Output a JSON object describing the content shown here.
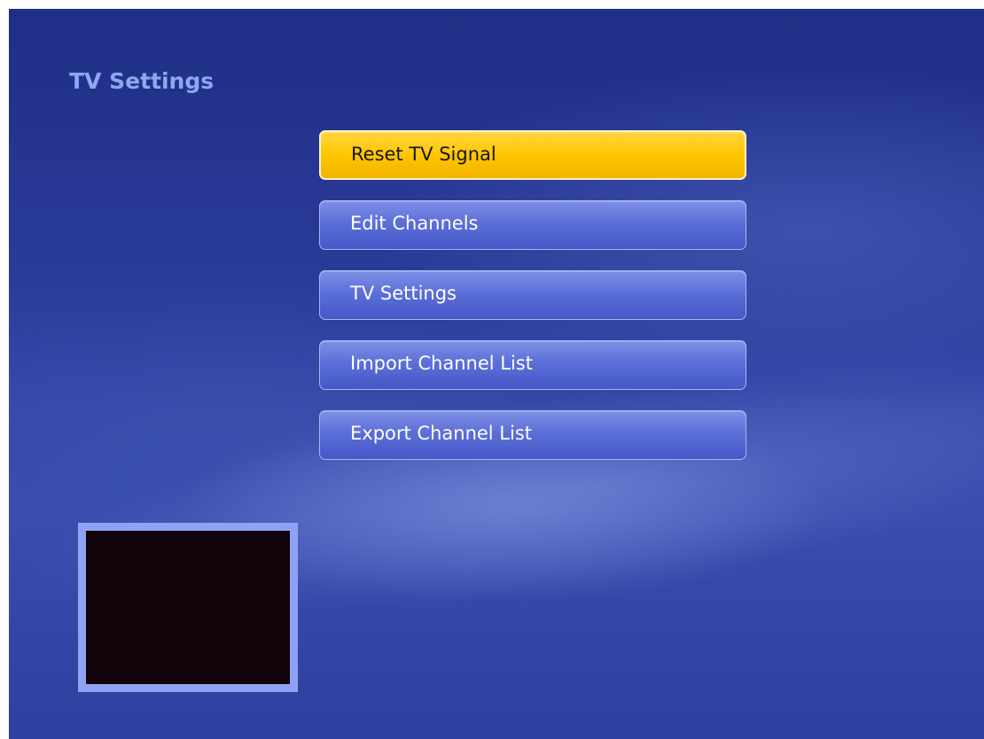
{
  "page": {
    "title": "TV Settings"
  },
  "menu": {
    "items": [
      {
        "label": "Reset TV Signal",
        "focused": true
      },
      {
        "label": "Edit Channels",
        "focused": false
      },
      {
        "label": "TV Settings",
        "focused": false
      },
      {
        "label": "Import Channel List",
        "focused": false
      },
      {
        "label": "Export Channel List",
        "focused": false
      }
    ]
  },
  "colors": {
    "background": "#2a3a98",
    "title": "#8fa6f0",
    "menu_item": "#5c6fd8",
    "menu_item_focused": "#ffc600",
    "preview_frame": "#8ea3f3",
    "preview_screen": "#12020a"
  }
}
